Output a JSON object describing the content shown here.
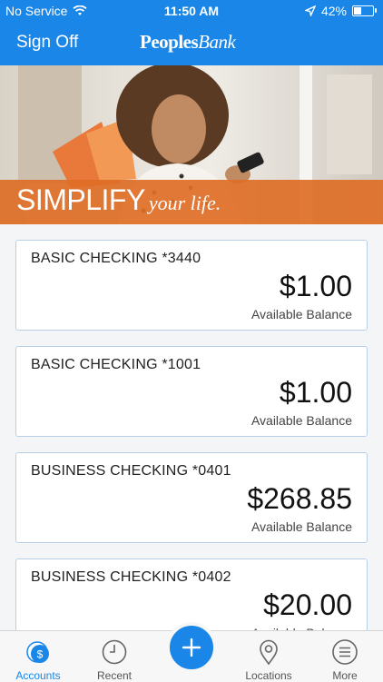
{
  "status": {
    "carrier": "No Service",
    "time": "11:50 AM",
    "battery": "42%",
    "battery_level": 0.42
  },
  "header": {
    "sign_off": "Sign Off",
    "logo_bold": "Peoples",
    "logo_italic": "Bank"
  },
  "banner": {
    "headline": "SIMPLIFY",
    "tagline": "your life."
  },
  "accounts": [
    {
      "name": "BASIC CHECKING *3440",
      "amount": "$1.00",
      "label": "Available Balance"
    },
    {
      "name": "BASIC CHECKING *1001",
      "amount": "$1.00",
      "label": "Available Balance"
    },
    {
      "name": "BUSINESS CHECKING *0401",
      "amount": "$268.85",
      "label": "Available Balance"
    },
    {
      "name": "BUSINESS CHECKING *0402",
      "amount": "$20.00",
      "label": "Available Balance"
    }
  ],
  "tabs": {
    "accounts": "Accounts",
    "recent": "Recent",
    "locations": "Locations",
    "more": "More"
  },
  "colors": {
    "primary": "#1a86e8",
    "banner_accent": "#de6e26"
  }
}
